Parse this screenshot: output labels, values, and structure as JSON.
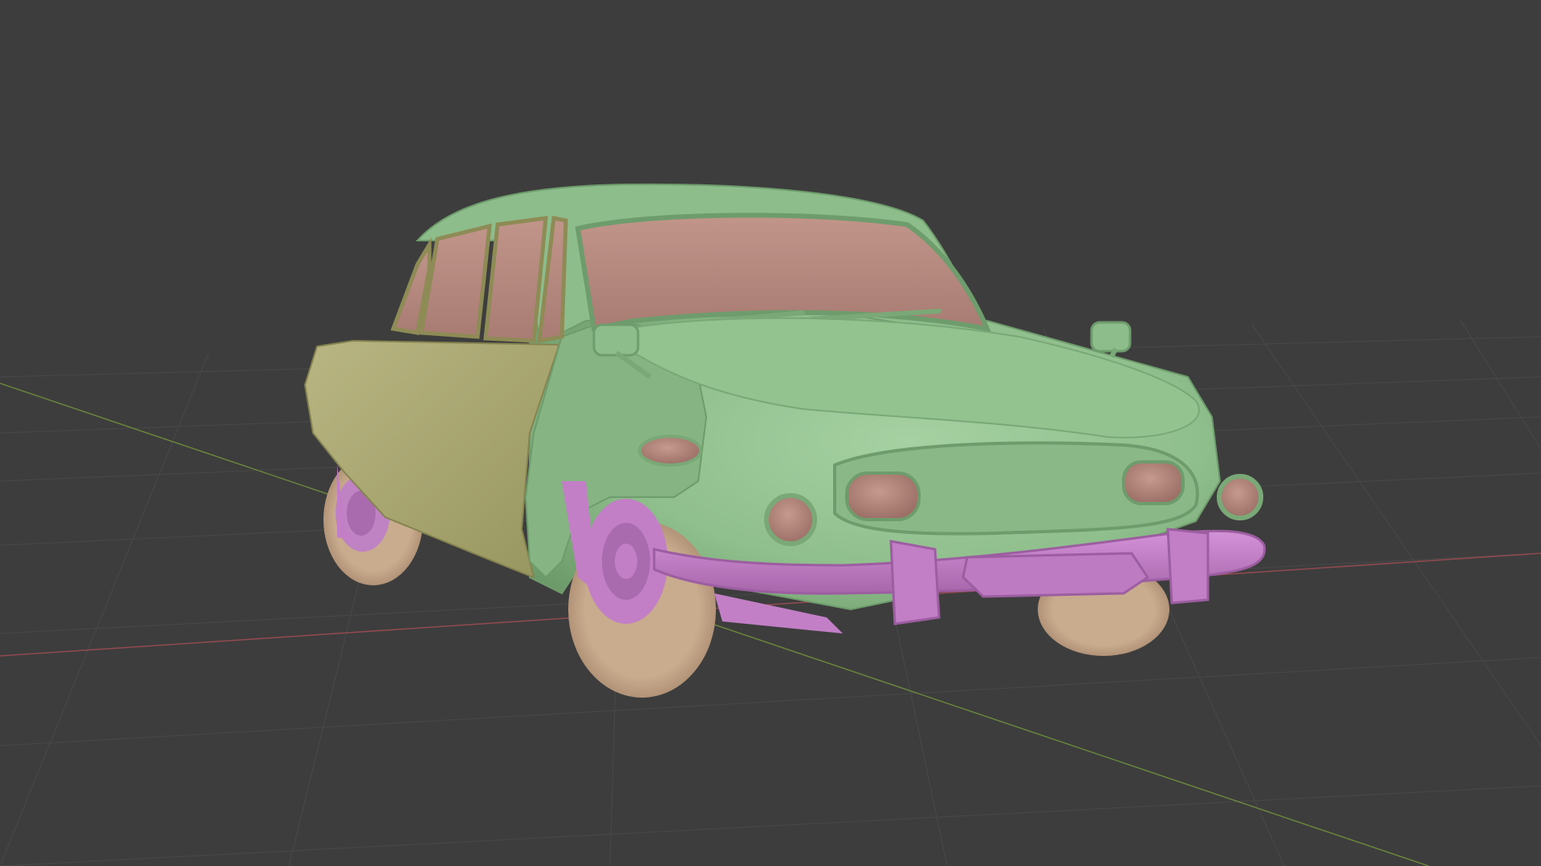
{
  "viewport": {
    "background_color": "#3d3d3d",
    "grid_color": "#4a4a4a",
    "x_axis_color": "#9a4a4f",
    "y_axis_color": "#6c8a3a"
  },
  "model": {
    "body_color": "#8fbf8c",
    "body_shade_color": "#76a574",
    "door_panel_color": "#b3b17d",
    "glass_color": "#b8897e",
    "trim_color": "#c27fc6",
    "tire_color": "#c4a68a",
    "lamp_color": "#b8897e"
  }
}
